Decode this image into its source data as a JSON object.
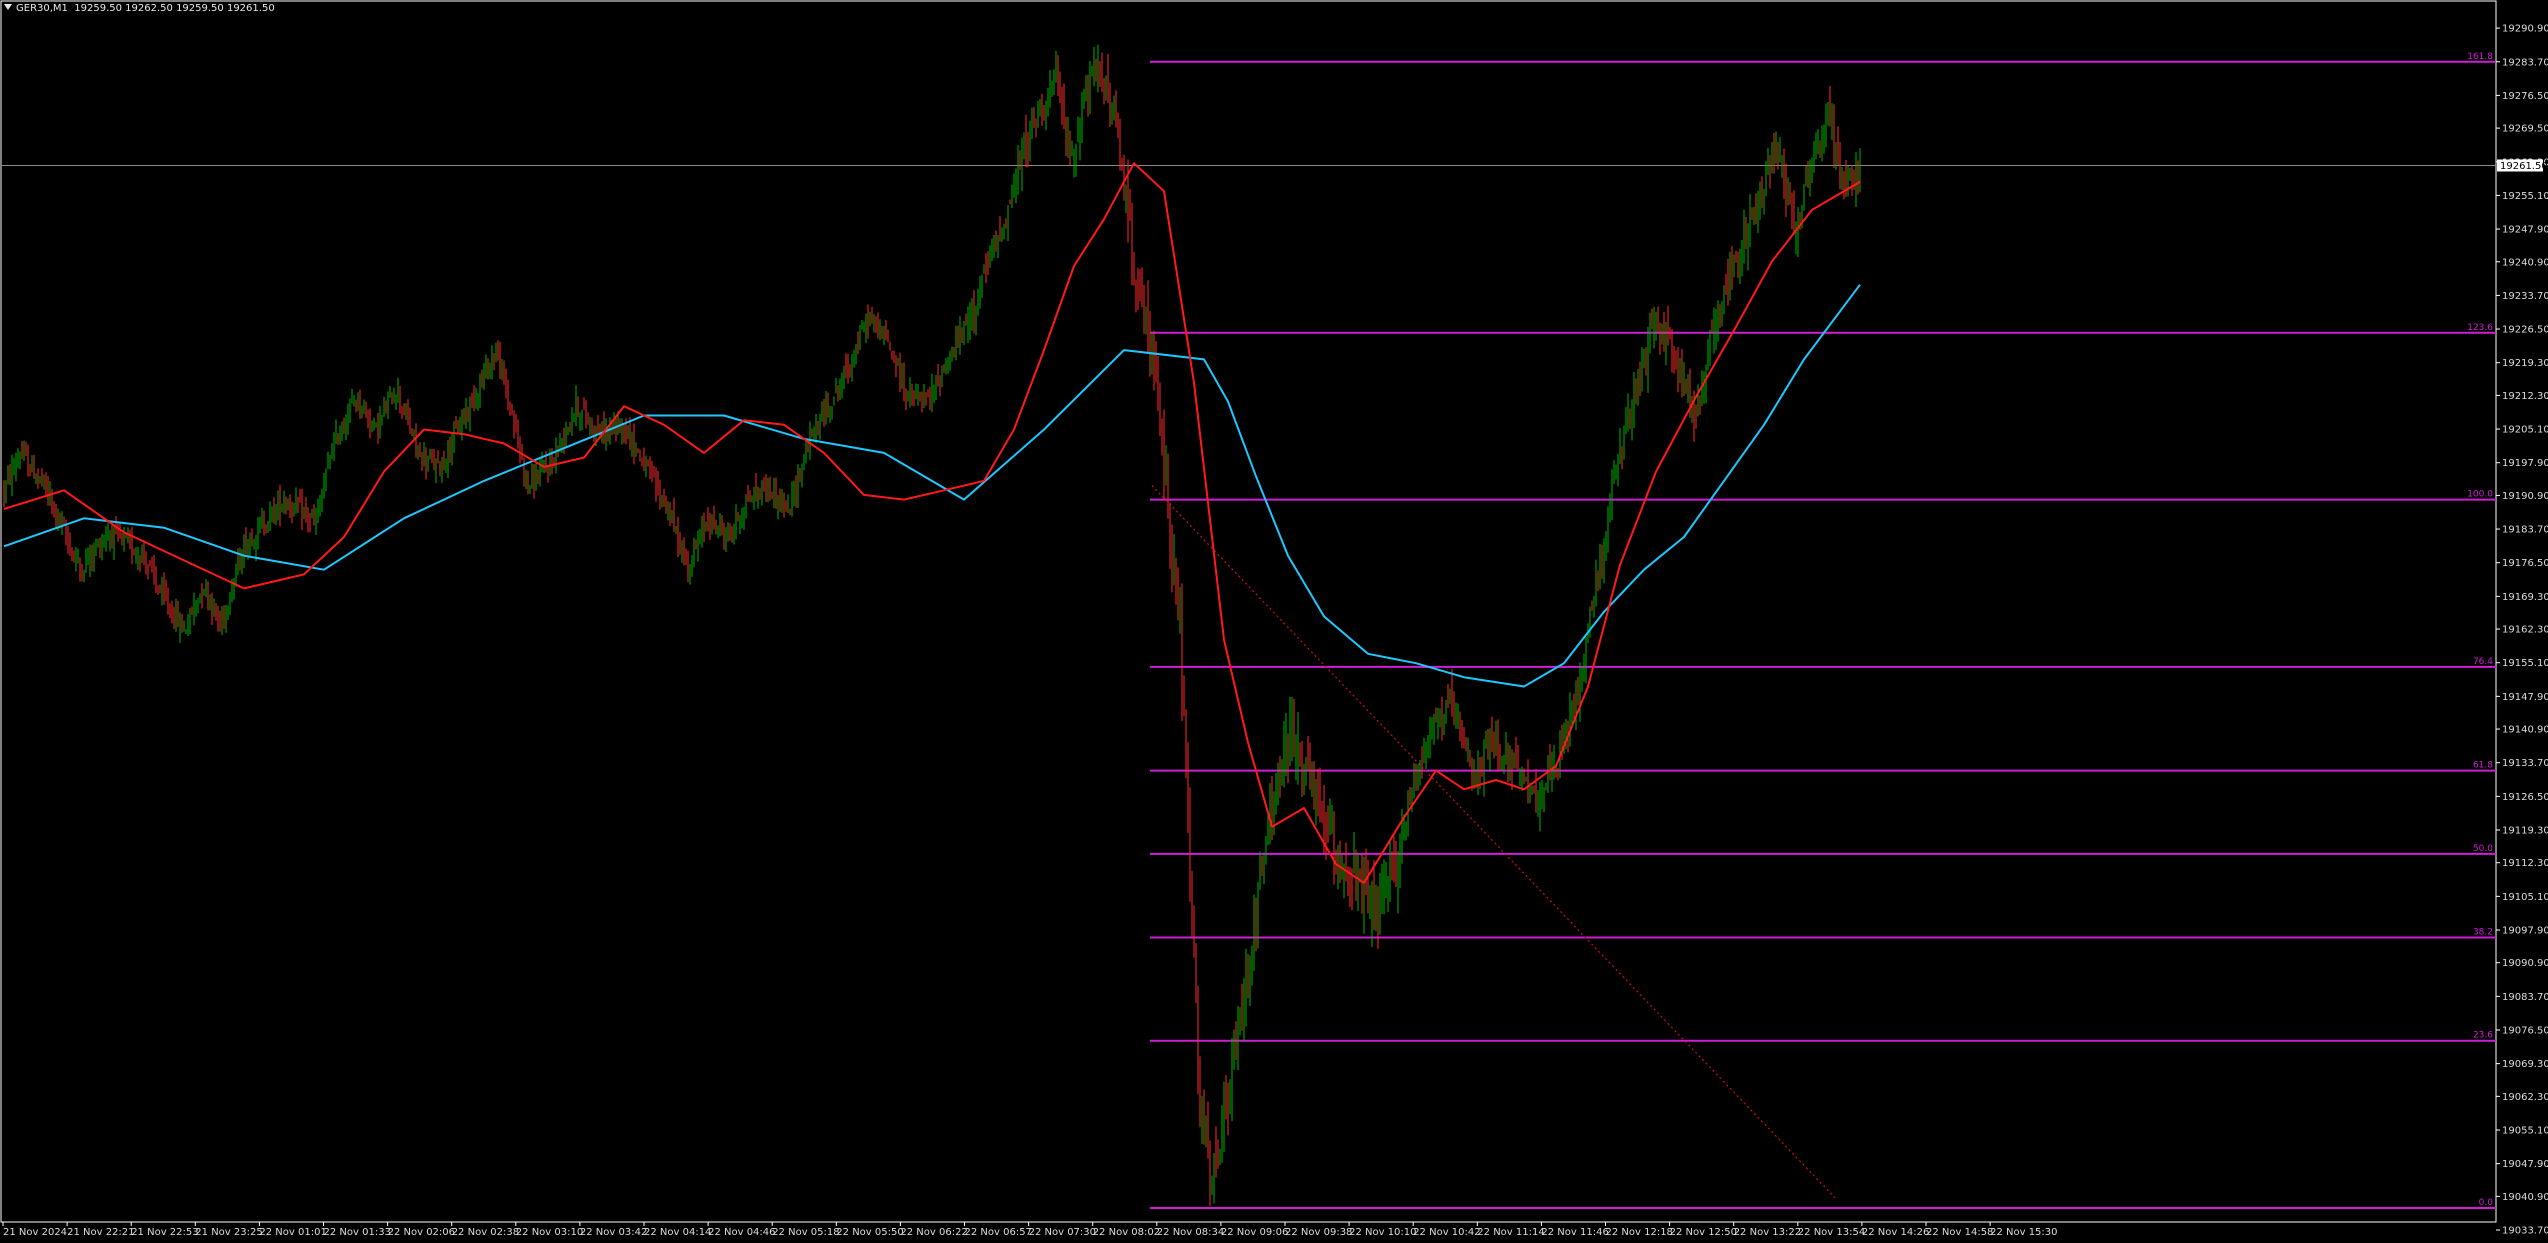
{
  "header": {
    "symbol": "GER30,M1",
    "ohlc": "19259.50 19262.50 19259.50 19261.50"
  },
  "colors": {
    "background": "#000000",
    "frame": "#ffffff",
    "bull_candle": "#00b400",
    "bear_candle": "#ff2a2a",
    "ma_fast": "#ff1a1a",
    "ma_slow": "#1ec8ff",
    "fib_level": "#d01ed6",
    "fib_trend": "#c81414",
    "price_line": "#8a8a8a",
    "axis_text": "#dcdcdc"
  },
  "chart_data": {
    "type": "candlestick",
    "instrument": "GER30",
    "timeframe": "M1",
    "ylim": [
      19033.7,
      19293.0
    ],
    "current_price": "19261.50",
    "y_ticks": [
      "19290.90",
      "19283.70",
      "19276.50",
      "19269.50",
      "19262.30",
      "19255.10",
      "19247.90",
      "19240.90",
      "19233.70",
      "19226.50",
      "19219.30",
      "19212.30",
      "19205.10",
      "19197.90",
      "19190.90",
      "19183.70",
      "19176.50",
      "19169.30",
      "19162.30",
      "19155.10",
      "19147.90",
      "19140.90",
      "19133.70",
      "19126.50",
      "19119.30",
      "19112.30",
      "19105.10",
      "19097.90",
      "19090.90",
      "19083.70",
      "19076.50",
      "19069.30",
      "19062.30",
      "19055.10",
      "19047.90",
      "19040.90",
      "19033.70"
    ],
    "x_ticks": [
      "21 Nov 2024",
      "21 Nov 22:21",
      "21 Nov 22:53",
      "21 Nov 23:25",
      "22 Nov 01:01",
      "22 Nov 01:33",
      "22 Nov 02:06",
      "22 Nov 02:38",
      "22 Nov 03:10",
      "22 Nov 03:42",
      "22 Nov 04:14",
      "22 Nov 04:46",
      "22 Nov 05:18",
      "22 Nov 05:50",
      "22 Nov 06:22",
      "22 Nov 06:57",
      "22 Nov 07:30",
      "22 Nov 08:02",
      "22 Nov 08:34",
      "22 Nov 09:06",
      "22 Nov 09:38",
      "22 Nov 10:10",
      "22 Nov 10:42",
      "22 Nov 11:14",
      "22 Nov 11:46",
      "22 Nov 12:18",
      "22 Nov 12:50",
      "22 Nov 13:22",
      "22 Nov 13:54",
      "22 Nov 14:26",
      "22 Nov 14:58",
      "22 Nov 15:30"
    ],
    "price_path": [
      [
        0,
        19192
      ],
      [
        8,
        19200
      ],
      [
        20,
        19193
      ],
      [
        30,
        19183
      ],
      [
        38,
        19175
      ],
      [
        52,
        19183
      ],
      [
        70,
        19178
      ],
      [
        78,
        19170
      ],
      [
        90,
        19162
      ],
      [
        100,
        19172
      ],
      [
        108,
        19163
      ],
      [
        120,
        19180
      ],
      [
        132,
        19186
      ],
      [
        140,
        19190
      ],
      [
        156,
        19185
      ],
      [
        164,
        19201
      ],
      [
        176,
        19212
      ],
      [
        186,
        19205
      ],
      [
        196,
        19214
      ],
      [
        208,
        19199
      ],
      [
        218,
        19197
      ],
      [
        228,
        19206
      ],
      [
        238,
        19215
      ],
      [
        246,
        19222
      ],
      [
        254,
        19208
      ],
      [
        262,
        19193
      ],
      [
        274,
        19198
      ],
      [
        286,
        19210
      ],
      [
        298,
        19204
      ],
      [
        310,
        19206
      ],
      [
        322,
        19196
      ],
      [
        332,
        19188
      ],
      [
        342,
        19175
      ],
      [
        352,
        19186
      ],
      [
        362,
        19182
      ],
      [
        372,
        19190
      ],
      [
        382,
        19193
      ],
      [
        392,
        19187
      ],
      [
        402,
        19202
      ],
      [
        412,
        19210
      ],
      [
        422,
        19218
      ],
      [
        432,
        19229
      ],
      [
        442,
        19224
      ],
      [
        452,
        19212
      ],
      [
        462,
        19211
      ],
      [
        472,
        19220
      ],
      [
        482,
        19228
      ],
      [
        492,
        19240
      ],
      [
        502,
        19252
      ],
      [
        510,
        19265
      ],
      [
        518,
        19274
      ],
      [
        526,
        19280
      ],
      [
        534,
        19262
      ],
      [
        540,
        19276
      ],
      [
        548,
        19283
      ],
      [
        556,
        19270
      ],
      [
        566,
        19238
      ],
      [
        576,
        19215
      ],
      [
        588,
        19162
      ],
      [
        598,
        19060
      ],
      [
        604,
        19042
      ],
      [
        614,
        19066
      ],
      [
        624,
        19095
      ],
      [
        634,
        19125
      ],
      [
        644,
        19140
      ],
      [
        654,
        19128
      ],
      [
        664,
        19116
      ],
      [
        674,
        19110
      ],
      [
        684,
        19101
      ],
      [
        694,
        19108
      ],
      [
        704,
        19128
      ],
      [
        714,
        19142
      ],
      [
        724,
        19146
      ],
      [
        734,
        19130
      ],
      [
        744,
        19138
      ],
      [
        754,
        19134
      ],
      [
        764,
        19126
      ],
      [
        776,
        19132
      ],
      [
        786,
        19147
      ],
      [
        796,
        19172
      ],
      [
        806,
        19196
      ],
      [
        816,
        19213
      ],
      [
        826,
        19229
      ],
      [
        836,
        19220
      ],
      [
        846,
        19207
      ],
      [
        856,
        19230
      ],
      [
        866,
        19241
      ],
      [
        876,
        19252
      ],
      [
        886,
        19267
      ],
      [
        896,
        19248
      ],
      [
        904,
        19263
      ],
      [
        912,
        19272
      ],
      [
        920,
        19258
      ],
      [
        928,
        19261
      ]
    ],
    "ma_fast": [
      [
        0,
        19188
      ],
      [
        30,
        19192
      ],
      [
        60,
        19183
      ],
      [
        90,
        19177
      ],
      [
        120,
        19171
      ],
      [
        150,
        19174
      ],
      [
        170,
        19182
      ],
      [
        190,
        19196
      ],
      [
        210,
        19205
      ],
      [
        230,
        19204
      ],
      [
        250,
        19202
      ],
      [
        270,
        19197
      ],
      [
        290,
        19199
      ],
      [
        310,
        19210
      ],
      [
        330,
        19206
      ],
      [
        350,
        19200
      ],
      [
        370,
        19207
      ],
      [
        390,
        19206
      ],
      [
        410,
        19200
      ],
      [
        430,
        19191
      ],
      [
        450,
        19190
      ],
      [
        470,
        19192
      ],
      [
        490,
        19194
      ],
      [
        505,
        19205
      ],
      [
        520,
        19222
      ],
      [
        535,
        19240
      ],
      [
        550,
        19250
      ],
      [
        565,
        19262
      ],
      [
        580,
        19256
      ],
      [
        595,
        19215
      ],
      [
        610,
        19160
      ],
      [
        622,
        19138
      ],
      [
        634,
        19120
      ],
      [
        650,
        19124
      ],
      [
        666,
        19112
      ],
      [
        680,
        19108
      ],
      [
        700,
        19122
      ],
      [
        716,
        19132
      ],
      [
        730,
        19128
      ],
      [
        746,
        19130
      ],
      [
        760,
        19128
      ],
      [
        776,
        19133
      ],
      [
        792,
        19150
      ],
      [
        808,
        19176
      ],
      [
        826,
        19196
      ],
      [
        846,
        19212
      ],
      [
        866,
        19227
      ],
      [
        884,
        19241
      ],
      [
        904,
        19252
      ],
      [
        928,
        19258
      ]
    ],
    "ma_slow": [
      [
        0,
        19180
      ],
      [
        40,
        19186
      ],
      [
        80,
        19184
      ],
      [
        120,
        19178
      ],
      [
        160,
        19175
      ],
      [
        200,
        19186
      ],
      [
        240,
        19194
      ],
      [
        280,
        19201
      ],
      [
        320,
        19208
      ],
      [
        360,
        19208
      ],
      [
        400,
        19203
      ],
      [
        440,
        19200
      ],
      [
        480,
        19190
      ],
      [
        520,
        19205
      ],
      [
        560,
        19222
      ],
      [
        600,
        19220
      ],
      [
        612,
        19211
      ],
      [
        626,
        19195
      ],
      [
        642,
        19178
      ],
      [
        660,
        19165
      ],
      [
        682,
        19157
      ],
      [
        706,
        19155
      ],
      [
        730,
        19152
      ],
      [
        760,
        19150
      ],
      [
        780,
        19155
      ],
      [
        800,
        19166
      ],
      [
        820,
        19175
      ],
      [
        840,
        19182
      ],
      [
        860,
        19194
      ],
      [
        880,
        19206
      ],
      [
        900,
        19220
      ],
      [
        928,
        19236
      ]
    ],
    "fib_trend": {
      "from": [
        574,
        19193
      ],
      "to": [
        916,
        19040.4
      ]
    },
    "fib_levels": [
      {
        "label": "161.8",
        "price": 19283.7
      },
      {
        "label": "123.6",
        "price": 19225.7
      },
      {
        "label": "100.0",
        "price": 19190.0
      },
      {
        "label": "76.4",
        "price": 19154.2
      },
      {
        "label": "61.8",
        "price": 19132.0
      },
      {
        "label": "50.0",
        "price": 19114.2
      },
      {
        "label": "38.2",
        "price": 19096.3
      },
      {
        "label": "23.6",
        "price": 19074.2
      },
      {
        "label": "0.0",
        "price": 19038.4
      }
    ]
  }
}
